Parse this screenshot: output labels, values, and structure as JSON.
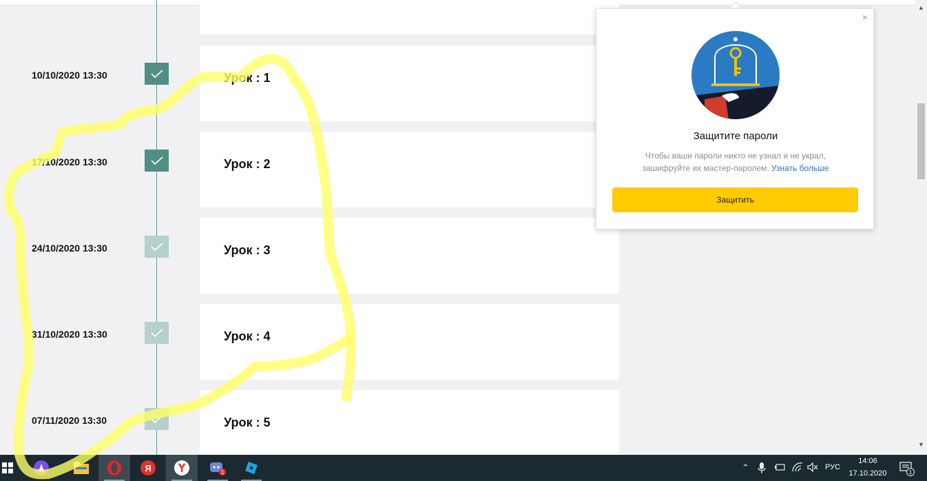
{
  "lessons": [
    {
      "date": "10/10/2020 13:30",
      "title": "Урок : 1",
      "status": "done"
    },
    {
      "date": "17/10/2020 13:30",
      "title": "Урок : 2",
      "status": "done"
    },
    {
      "date": "24/10/2020 13:30",
      "title": "Урок : 3",
      "status": "pending"
    },
    {
      "date": "31/10/2020 13:30",
      "title": "Урок : 4",
      "status": "pending"
    },
    {
      "date": "07/11/2020 13:30",
      "title": "Урок : 5",
      "status": "pending"
    }
  ],
  "popup": {
    "close_label": "×",
    "title": "Защитите пароли",
    "text_line1": "Чтобы ваши пароли никто не узнал и не украл,",
    "text_line2": "зашифруйте их мастер-паролем.",
    "link": "Узнать больше",
    "button": "Защитить"
  },
  "taskbar": {
    "apps": [
      "windows-start",
      "alice",
      "file-explorer",
      "opera",
      "yandex-ya",
      "yandex-browser",
      "discord",
      "roblox-studio"
    ],
    "discord_badge": "1",
    "language": "РУС",
    "time": "14:06",
    "date": "17.10.2020",
    "notifications": "1"
  },
  "colors": {
    "check_done": "#4f8f86",
    "check_pending": "#b6d0cc",
    "popup_button": "#ffcc00",
    "link": "#2b6fc5",
    "scribble": "#ffff66"
  }
}
